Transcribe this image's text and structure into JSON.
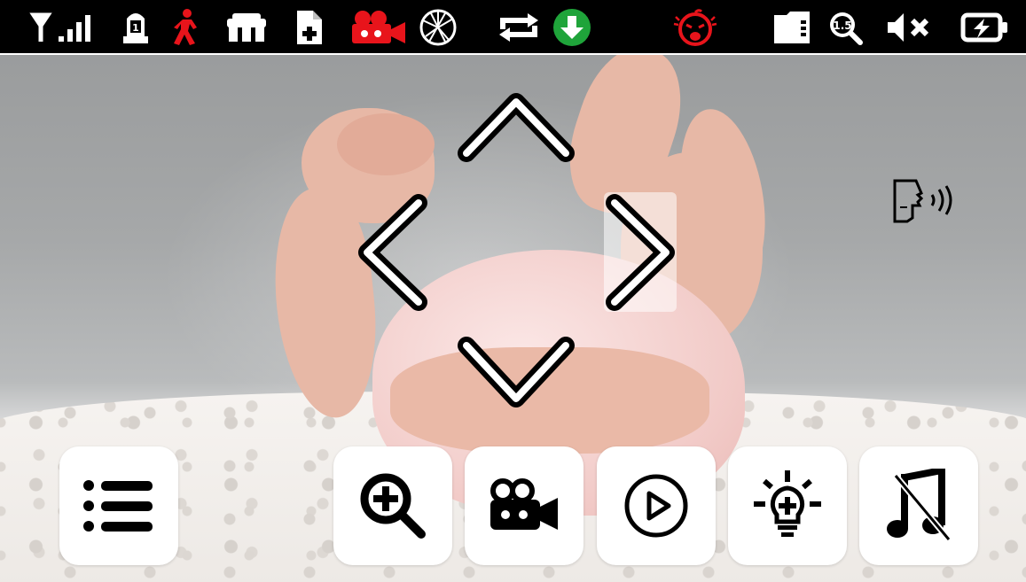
{
  "status_bar": {
    "icons": [
      "signal-strength-icon",
      "lullaby-temperature-icon",
      "motion-detect-icon",
      "camera-group-icon",
      "add-file-icon",
      "recording-video-icon",
      "network-globe-icon",
      "repeat-icon",
      "download-icon",
      "baby-crying-icon",
      "sd-card-icon",
      "zoom-level-icon",
      "mute-speaker-icon",
      "battery-charging-icon"
    ],
    "zoom_level": "1.5",
    "lullaby_label": "1"
  },
  "colors": {
    "alert_red": "#e8141b",
    "download_green": "#1fa43a",
    "bar_bg": "#000000"
  },
  "ptz": {
    "up_icon": "chevron-up-icon",
    "down_icon": "chevron-down-icon",
    "left_icon": "chevron-left-icon",
    "right_icon": "chevron-right-icon",
    "active": "right"
  },
  "bottom_bar": {
    "buttons": [
      "menu-icon",
      "zoom-in-icon",
      "video-record-icon",
      "playback-icon",
      "night-light-icon",
      "music-off-icon"
    ]
  },
  "talk_icon": "push-to-talk-icon"
}
